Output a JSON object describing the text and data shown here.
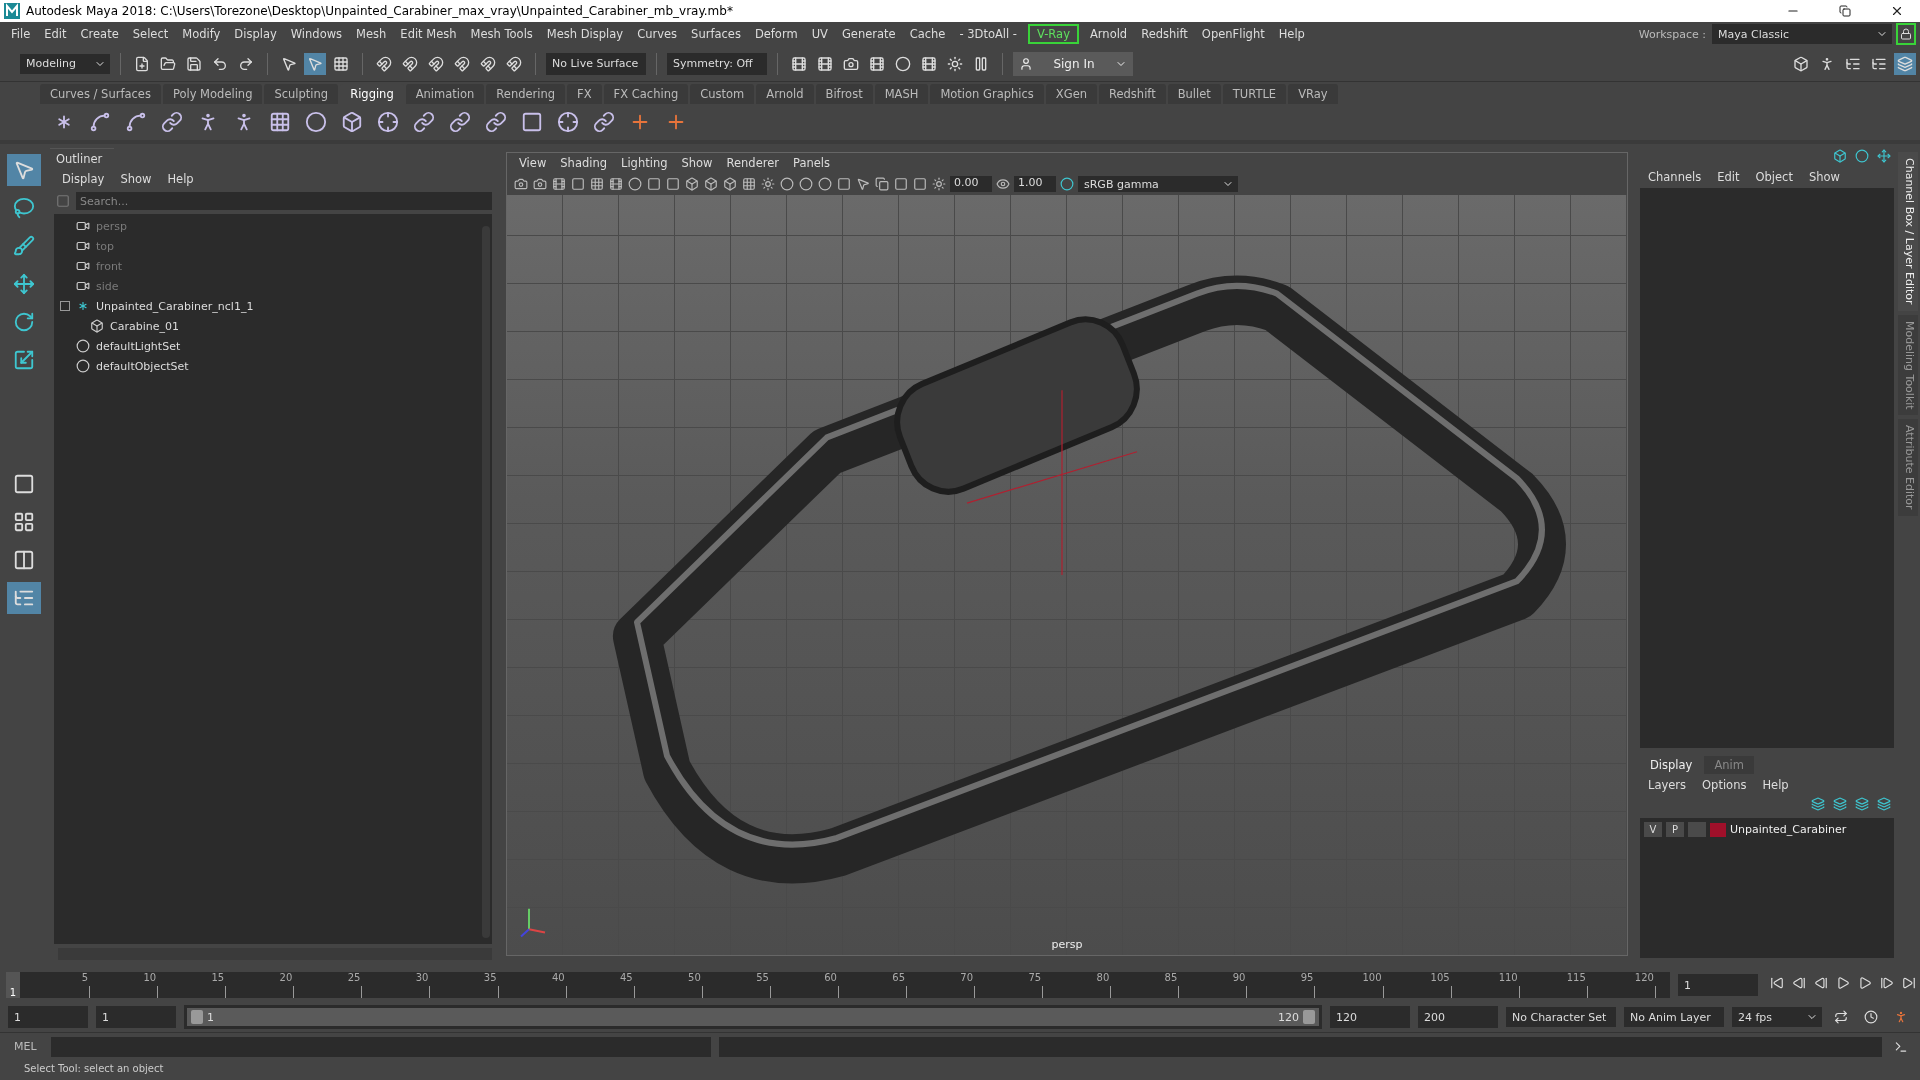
{
  "window": {
    "title": "Autodesk Maya 2018: C:\\Users\\Torezone\\Desktop\\Unpainted_Carabiner_max_vray\\Unpainted_Carabiner_mb_vray.mb*"
  },
  "menu": [
    {
      "label": "File",
      "highlighted": false
    },
    {
      "label": "Edit",
      "highlighted": false
    },
    {
      "label": "Create",
      "highlighted": false
    },
    {
      "label": "Select",
      "highlighted": false
    },
    {
      "label": "Modify",
      "highlighted": false
    },
    {
      "label": "Display",
      "highlighted": false
    },
    {
      "label": "Windows",
      "highlighted": false
    },
    {
      "label": "Mesh",
      "highlighted": false
    },
    {
      "label": "Edit Mesh",
      "highlighted": false
    },
    {
      "label": "Mesh Tools",
      "highlighted": false
    },
    {
      "label": "Mesh Display",
      "highlighted": false
    },
    {
      "label": "Curves",
      "highlighted": false
    },
    {
      "label": "Surfaces",
      "highlighted": false
    },
    {
      "label": "Deform",
      "highlighted": false
    },
    {
      "label": "UV",
      "highlighted": false
    },
    {
      "label": "Generate",
      "highlighted": false
    },
    {
      "label": "Cache",
      "highlighted": false
    },
    {
      "label": "- 3DtoAll -",
      "highlighted": false
    },
    {
      "label": "V-Ray",
      "highlighted": true
    },
    {
      "label": "Arnold",
      "highlighted": false
    },
    {
      "label": "Redshift",
      "highlighted": false
    },
    {
      "label": "OpenFlight",
      "highlighted": false
    },
    {
      "label": "Help",
      "highlighted": false
    }
  ],
  "workspace": {
    "label": "Workspace :",
    "value": "Maya Classic"
  },
  "toolbar": {
    "mode": "Modeling",
    "live_surface": "No Live Surface",
    "symmetry": "Symmetry: Off",
    "sign_in": "Sign In"
  },
  "shelf_tabs": [
    {
      "label": "Curves / Surfaces",
      "selected": false
    },
    {
      "label": "Poly Modeling",
      "selected": false
    },
    {
      "label": "Sculpting",
      "selected": false
    },
    {
      "label": "Rigging",
      "selected": true
    },
    {
      "label": "Animation",
      "selected": false
    },
    {
      "label": "Rendering",
      "selected": false
    },
    {
      "label": "FX",
      "selected": false
    },
    {
      "label": "FX Caching",
      "selected": false
    },
    {
      "label": "Custom",
      "selected": false
    },
    {
      "label": "Arnold",
      "selected": false
    },
    {
      "label": "Bifrost",
      "selected": false
    },
    {
      "label": "MASH",
      "selected": false
    },
    {
      "label": "Motion Graphics",
      "selected": false
    },
    {
      "label": "XGen",
      "selected": false
    },
    {
      "label": "Redshift",
      "selected": false
    },
    {
      "label": "Bullet",
      "selected": false
    },
    {
      "label": "TURTLE",
      "selected": false
    },
    {
      "label": "VRay",
      "selected": false
    }
  ],
  "outliner": {
    "title": "Outliner",
    "menu": [
      "Display",
      "Show",
      "Help"
    ],
    "search": {
      "placeholder": "Search..."
    },
    "items": [
      {
        "label": "persp",
        "kind": "camera"
      },
      {
        "label": "top",
        "kind": "camera"
      },
      {
        "label": "front",
        "kind": "camera"
      },
      {
        "label": "side",
        "kind": "camera"
      },
      {
        "label": "Unpainted_Carabiner_ncl1_1",
        "kind": "group",
        "expanded": true,
        "children": [
          {
            "label": "Carabine_01",
            "kind": "mesh"
          }
        ]
      },
      {
        "label": "defaultLightSet",
        "kind": "set"
      },
      {
        "label": "defaultObjectSet",
        "kind": "set"
      }
    ]
  },
  "viewport": {
    "menu": [
      "View",
      "Shading",
      "Lighting",
      "Show",
      "Renderer",
      "Panels"
    ],
    "exposure": "0.00",
    "gamma": "1.00",
    "color_space": "sRGB gamma",
    "camera": "persp"
  },
  "channel_box": {
    "menu": [
      "Channels",
      "Edit",
      "Object",
      "Show"
    ]
  },
  "layer_editor": {
    "tabs": [
      {
        "label": "Display",
        "selected": true
      },
      {
        "label": "Anim",
        "selected": false
      }
    ],
    "menu": [
      "Layers",
      "Options",
      "Help"
    ],
    "layers": [
      {
        "visible": "V",
        "playback": "P",
        "color": "#a0102a",
        "name": "Unpainted_Carabiner"
      }
    ]
  },
  "side_tabs": [
    {
      "label": "Channel Box / Layer Editor",
      "selected": true
    },
    {
      "label": "Modeling Toolkit",
      "selected": false
    },
    {
      "label": "Attribute Editor",
      "selected": false
    }
  ],
  "timeline": {
    "current": "1",
    "level": 0,
    "ticks": [
      "5",
      "10",
      "15",
      "20",
      "25",
      "30",
      "35",
      "40",
      "45",
      "50",
      "55",
      "60",
      "65",
      "70",
      "75",
      "80",
      "85",
      "90",
      "95",
      "100",
      "105",
      "110",
      "115",
      "120"
    ],
    "frame_field": "1"
  },
  "range": {
    "level": 1,
    "start": "1",
    "playback_start": "1",
    "slider_start": "1",
    "slider_end": "120",
    "playback_end": "120",
    "end": "200",
    "character_set": "No Character Set",
    "anim_layer": "No Anim Layer",
    "fps": "24 fps"
  },
  "command_line": {
    "label": "MEL"
  },
  "help_line": "Select Tool: select an object"
}
